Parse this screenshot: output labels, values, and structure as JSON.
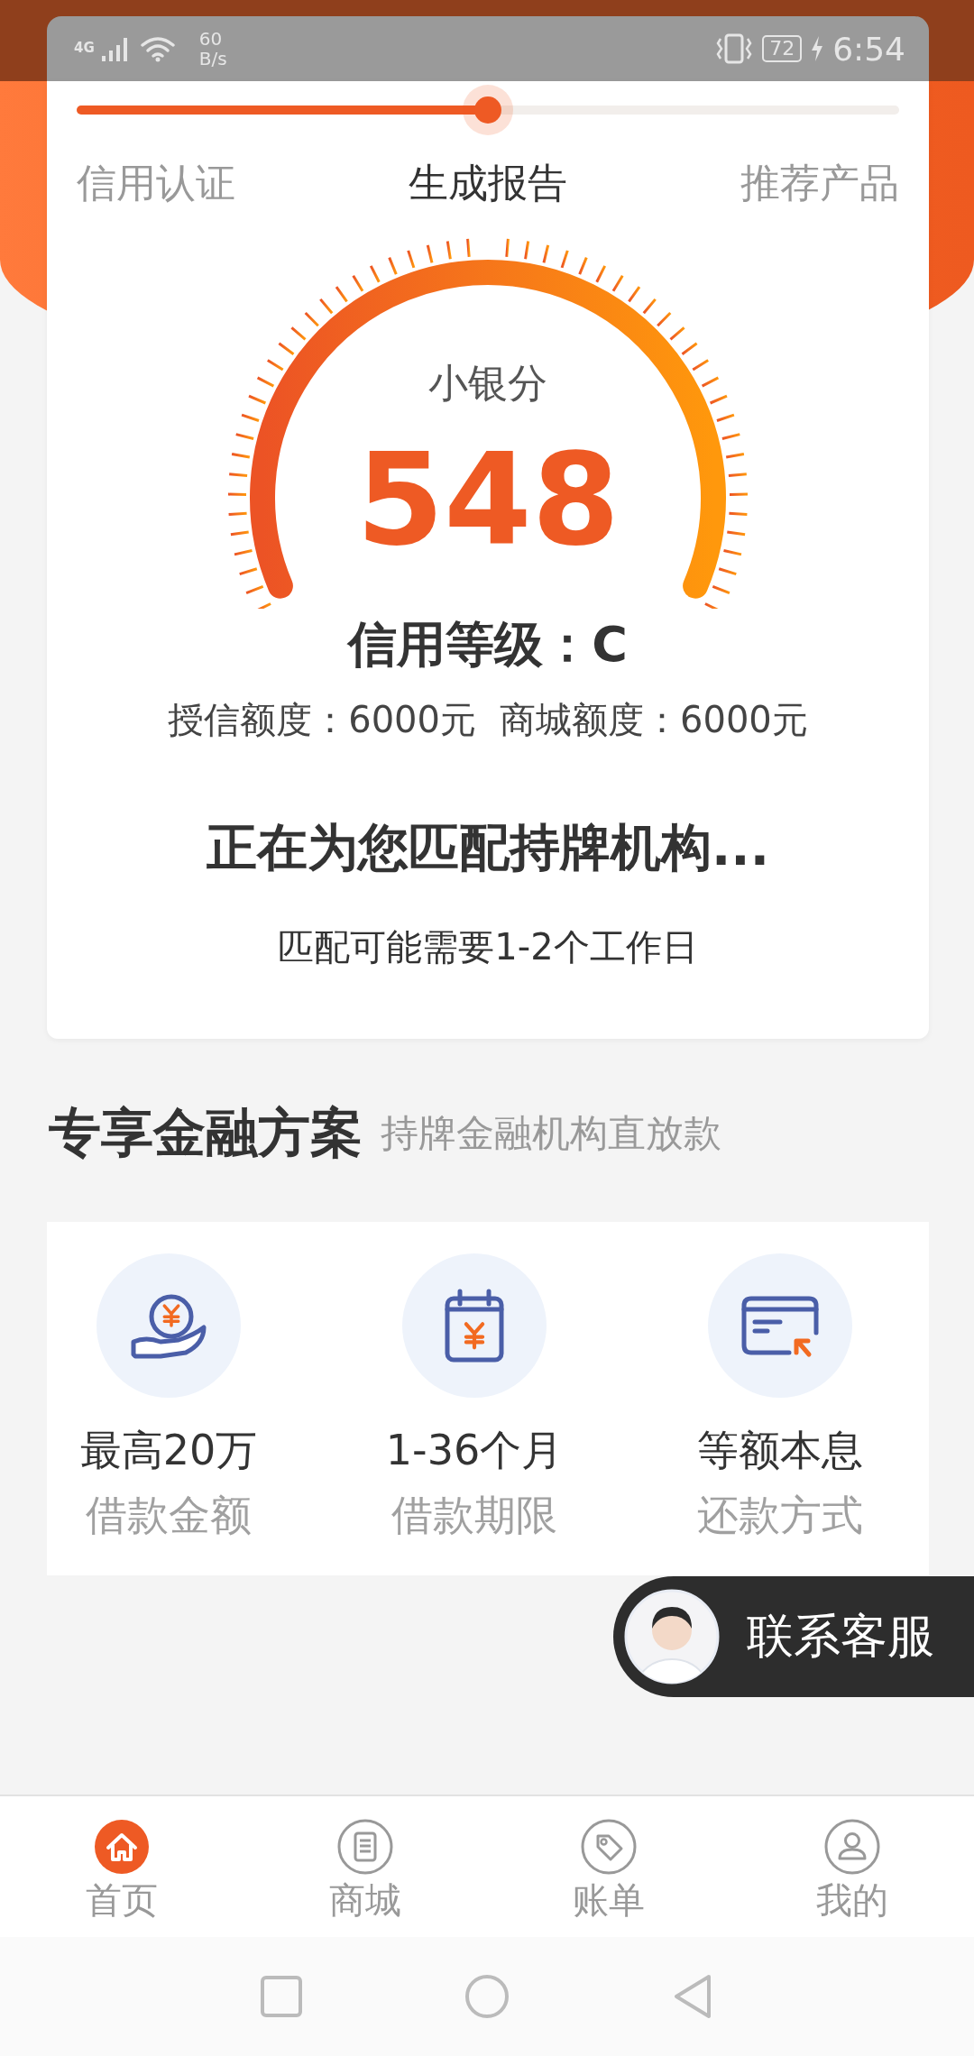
{
  "status_bar": {
    "network": "4G",
    "speed": "60",
    "speed_unit": "B/s",
    "battery": "72",
    "time": "6:54"
  },
  "progress": {
    "level": 0.5,
    "steps": [
      {
        "label": "信用认证",
        "selected": false
      },
      {
        "label": "生成报告",
        "selected": true
      },
      {
        "label": "推荐产品",
        "selected": false
      }
    ]
  },
  "score": {
    "label": "小银分",
    "value": "548"
  },
  "credit_grade": "信用等级：C",
  "limits": [
    "授信额度：6000元",
    "商城额度：6000元"
  ],
  "matching": {
    "title": "正在为您匹配持牌机构...",
    "note": "匹配可能需要1-2个工作日"
  },
  "section": {
    "title": "专享金融方案",
    "subtitle": "持牌金融机构直放款"
  },
  "features": [
    {
      "kind": "amount",
      "value": "最高20万",
      "label": "借款金额"
    },
    {
      "kind": "term",
      "value": "1-36个月",
      "label": "借款期限"
    },
    {
      "kind": "repayment",
      "value": "等额本息",
      "label": "还款方式"
    }
  ],
  "support_button": {
    "label": "联系客服"
  },
  "bottom_nav": [
    {
      "kind": "home",
      "label": "首页",
      "selected": true
    },
    {
      "kind": "mall",
      "label": "商城",
      "selected": false
    },
    {
      "kind": "bill",
      "label": "账单",
      "selected": false
    },
    {
      "kind": "me",
      "label": "我的",
      "selected": false
    }
  ]
}
